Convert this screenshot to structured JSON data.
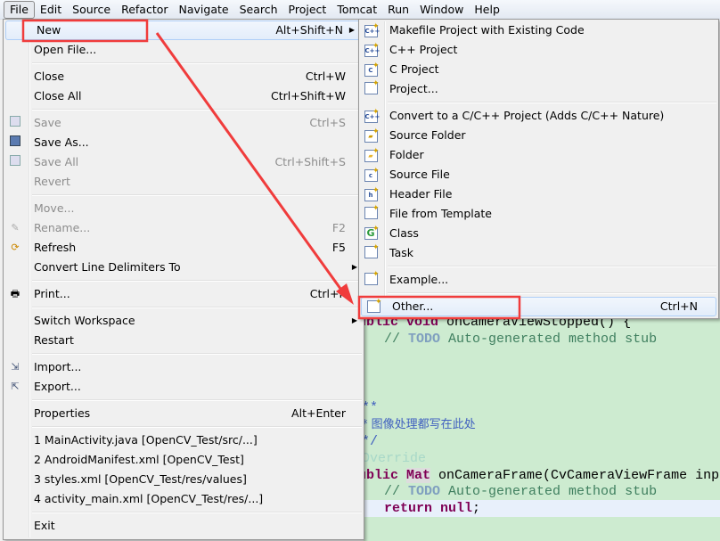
{
  "menubar": [
    "File",
    "Edit",
    "Source",
    "Refactor",
    "Navigate",
    "Search",
    "Project",
    "Tomcat",
    "Run",
    "Window",
    "Help"
  ],
  "file_menu": {
    "new": {
      "label": "New",
      "shortcut": "Alt+Shift+N"
    },
    "open_file": "Open File...",
    "close": {
      "label": "Close",
      "shortcut": "Ctrl+W"
    },
    "close_all": {
      "label": "Close All",
      "shortcut": "Ctrl+Shift+W"
    },
    "save": {
      "label": "Save",
      "shortcut": "Ctrl+S"
    },
    "save_as": "Save As...",
    "save_all": {
      "label": "Save All",
      "shortcut": "Ctrl+Shift+S"
    },
    "revert": "Revert",
    "move": "Move...",
    "rename": {
      "label": "Rename...",
      "shortcut": "F2"
    },
    "refresh": {
      "label": "Refresh",
      "shortcut": "F5"
    },
    "convert": "Convert Line Delimiters To",
    "print": {
      "label": "Print...",
      "shortcut": "Ctrl+P"
    },
    "switch_workspace": "Switch Workspace",
    "restart": "Restart",
    "import": "Import...",
    "export": "Export...",
    "properties": {
      "label": "Properties",
      "shortcut": "Alt+Enter"
    },
    "recent": [
      "1 MainActivity.java  [OpenCV_Test/src/...]",
      "2 AndroidManifest.xml  [OpenCV_Test]",
      "3 styles.xml  [OpenCV_Test/res/values]",
      "4 activity_main.xml  [OpenCV_Test/res/...]"
    ],
    "exit": "Exit"
  },
  "new_submenu": {
    "items1": [
      "Makefile Project with Existing Code",
      "C++ Project",
      "C Project",
      "Project..."
    ],
    "items2": [
      "Convert to a C/C++ Project (Adds C/C++ Nature)",
      "Source Folder",
      "Folder",
      "Source File",
      "Header File",
      "File from Template",
      "Class",
      "Task"
    ],
    "example": "Example...",
    "other": {
      "label": "Other...",
      "shortcut": "Ctrl+N"
    }
  },
  "code": {
    "l1a": "ublic ",
    "l1b": "void",
    " l1c": "",
    "l1d": " onCameraViewStopped() {",
    "comment_slashes": "// ",
    "todo": "TODO",
    "comment_rest": " Auto-generated method stub",
    "jd1": "**",
    "jd2": "* 图像处理都写在此处",
    "jd3": "*/",
    "ann": "Override",
    "l2a": "ublic ",
    "l2b": "Mat",
    " l2c": "",
    "l2d": " onCameraFrame(CvCameraViewFrame inp",
    "ret": "return",
    "nul": "null",
    ";": ";"
  },
  "annotation_color": "#f03c3c"
}
